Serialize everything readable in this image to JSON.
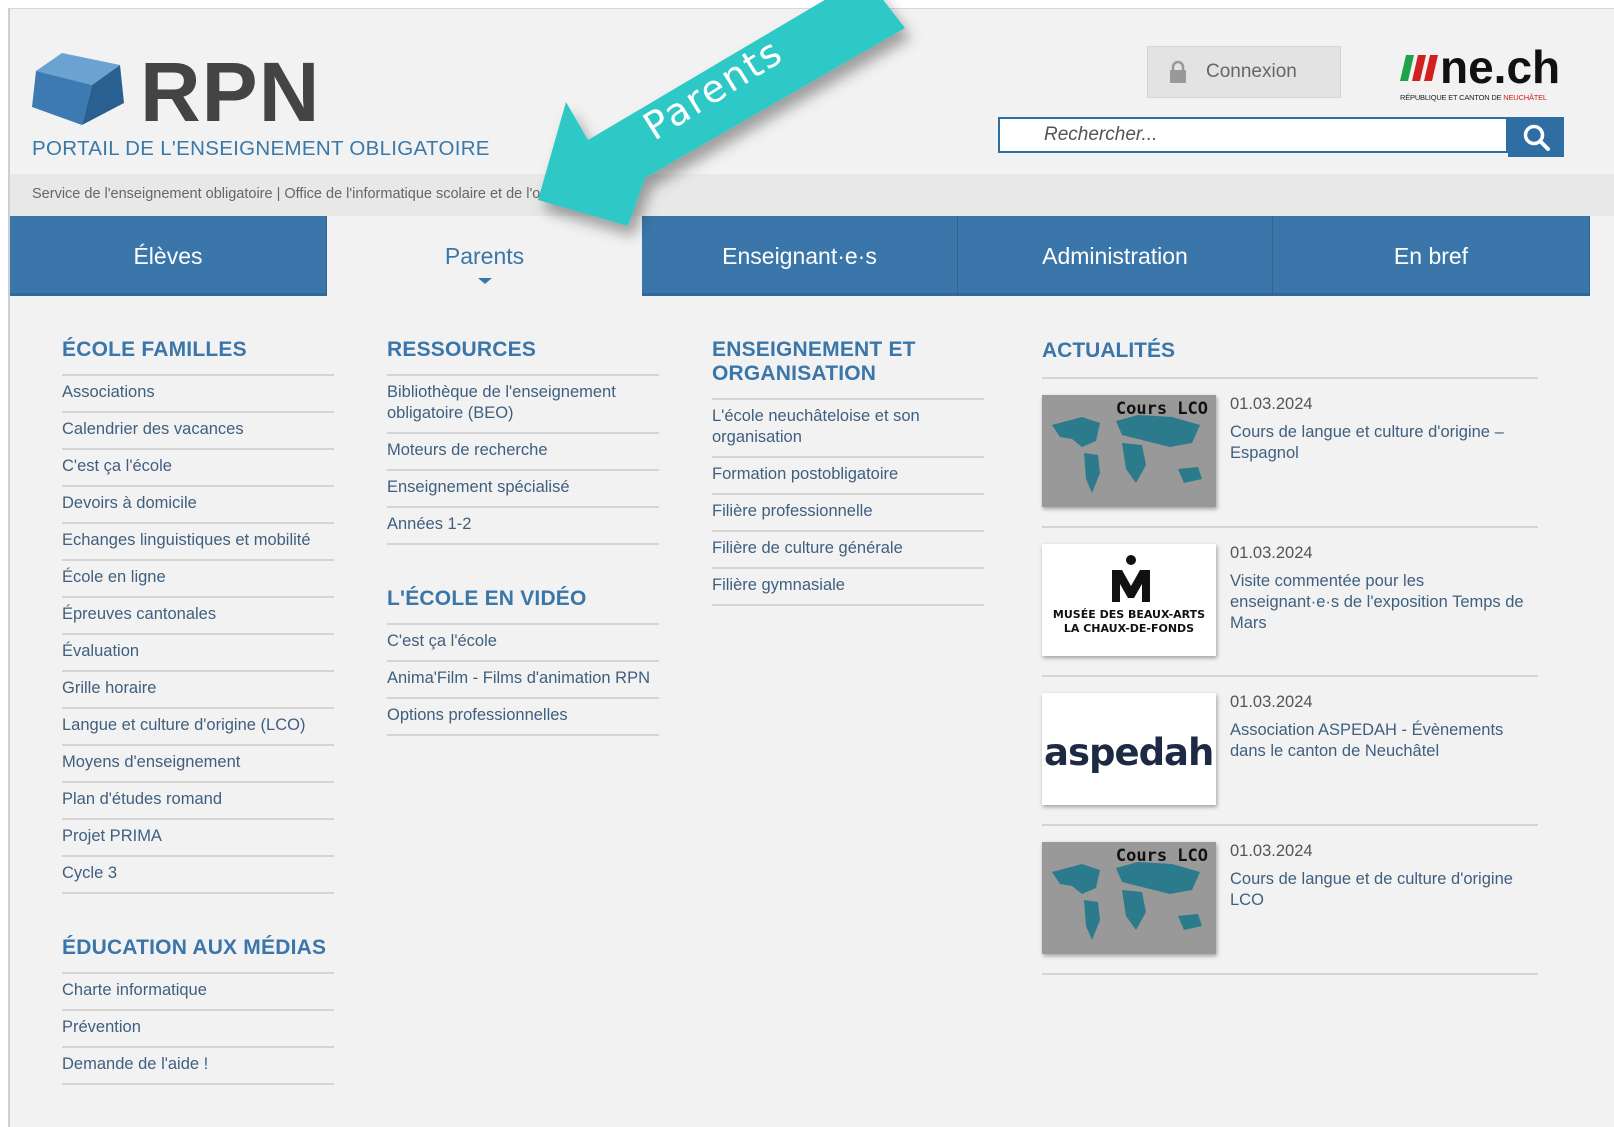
{
  "header": {
    "logo_text": "RPN",
    "portal_subtitle": "PORTAIL DE L'ENSEIGNEMENT OBLIGATOIRE",
    "login_label": "Connexion",
    "brand": {
      "main": "ne.ch",
      "sub_black": "RÉPUBLIQUE ET CANTON DE ",
      "sub_red": "NEUCHÂTEL"
    },
    "search_placeholder": "Rechercher...",
    "service_line": "Service de l'enseignement obligatoire | Office de l'informatique scolaire et de l'organisation"
  },
  "annotation": {
    "label": "Parents",
    "color": "#2ec9c6"
  },
  "nav": [
    {
      "label": "Élèves"
    },
    {
      "label": "Parents",
      "active": true
    },
    {
      "label": "Enseignant·e·s"
    },
    {
      "label": "Administration"
    },
    {
      "label": "En bref"
    }
  ],
  "columns": {
    "ecole_familles": {
      "title": "ÉCOLE FAMILLES",
      "items": [
        "Associations",
        "Calendrier des vacances",
        "C'est ça l'école",
        "Devoirs à domicile",
        "Echanges linguistiques et mobilité",
        "École en ligne",
        "Épreuves cantonales",
        "Évaluation",
        "Grille horaire",
        "Langue et culture d'origine (LCO)",
        "Moyens d'enseignement",
        "Plan d'études romand",
        "Projet PRIMA",
        "Cycle 3"
      ]
    },
    "education_medias": {
      "title": "ÉDUCATION AUX MÉDIAS",
      "items": [
        "Charte informatique",
        "Prévention",
        "Demande de l'aide !"
      ]
    },
    "ressources": {
      "title": "RESSOURCES",
      "items": [
        "Bibliothèque de l'enseignement obligatoire (BEO)",
        "Moteurs de recherche",
        "Enseignement spécialisé",
        "Années 1-2"
      ]
    },
    "ecole_video": {
      "title": "L'ÉCOLE EN VIDÉO",
      "items": [
        "C'est ça l'école",
        "Anima'Film - Films d'animation RPN",
        "Options professionnelles"
      ]
    },
    "enseignement": {
      "title": "ENSEIGNEMENT ET ORGANISATION",
      "items": [
        "L'école neuchâteloise et son organisation",
        "Formation postobligatoire",
        "Filière professionnelle",
        "Filière de culture générale",
        "Filière gymnasiale"
      ]
    }
  },
  "news": {
    "title": "ACTUALITÉS",
    "items": [
      {
        "date": "01.03.2024",
        "title": "Cours de langue et culture d'origine – Espagnol",
        "thumb_type": "lco",
        "thumb_label": "Cours LCO"
      },
      {
        "date": "01.03.2024",
        "title": "Visite commentée pour les enseignant·e·s de l'exposition Temps de Mars",
        "thumb_type": "musee",
        "thumb_line1": "MUSÉE DES BEAUX-ARTS",
        "thumb_line2": "LA CHAUX-DE-FONDS"
      },
      {
        "date": "01.03.2024",
        "title": "Association ASPEDAH - Évènements dans le canton de Neuchâtel",
        "thumb_type": "aspedah",
        "thumb_label": "aspedah"
      },
      {
        "date": "01.03.2024",
        "title": "Cours de langue et de culture d'origine LCO",
        "thumb_type": "lco",
        "thumb_label": "Cours LCO"
      }
    ]
  }
}
